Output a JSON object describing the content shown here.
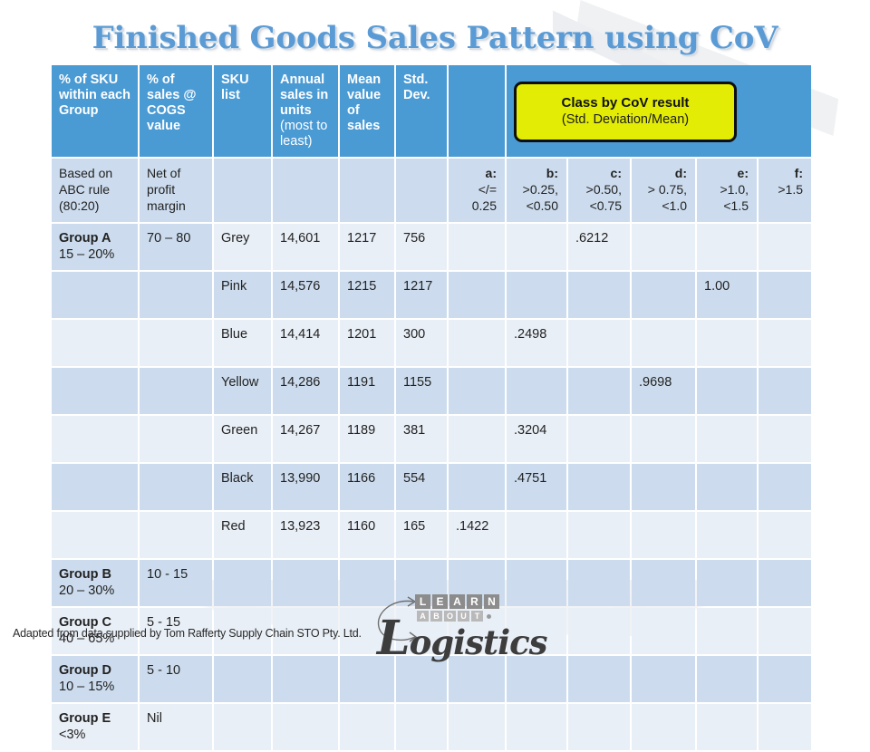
{
  "title": "Finished Goods Sales Pattern using CoV",
  "colors": {
    "title_blue": "#5b9bd5",
    "header_blue": "#4a9ad4",
    "row_light": "#e9eff7",
    "row_dark": "#ccdcee",
    "callout_yellow": "#e2ec05",
    "callout_border": "#0e0e0e"
  },
  "table": {
    "headers": {
      "pct_sku": "% of SKU within each Group",
      "pct_sales": "% of sales @ COGS value",
      "sku_list": "SKU list",
      "annual_sales_bold": "Annual sales in units",
      "annual_sales_light": "(most to least)",
      "mean_value": "Mean value of sales",
      "std_dev": "Std. Dev."
    },
    "callout": {
      "line1": "Class  by CoV result",
      "line2": "(Std.  Deviation/Mean)"
    },
    "subheaders": {
      "pct_sku": "Based on ABC rule (80:20)",
      "pct_sales": "Net of profit margin",
      "classes": [
        {
          "key": "a:",
          "range1": "</=",
          "range2": "0.25"
        },
        {
          "key": "b:",
          "range1": ">0.25,",
          "range2": "<0.50"
        },
        {
          "key": "c:",
          "range1": ">0.50,",
          "range2": "<0.75"
        },
        {
          "key": "d:",
          "range1": "> 0.75,",
          "range2": "<1.0"
        },
        {
          "key": "e:",
          "range1": ">1.0,",
          "range2": "<1.5"
        },
        {
          "key": "f:",
          "range1": ">1.5",
          "range2": ""
        }
      ]
    },
    "rows": [
      {
        "group_name": "Group A",
        "group_range": "15 – 20%",
        "pct_sales": "70 – 80",
        "sku": "Grey",
        "annual": "14,601",
        "mean": "1217",
        "std": "756",
        "a": "",
        "b": "",
        "c": ".6212",
        "d": "",
        "e": "",
        "f": "",
        "shade": "light",
        "group_shade": "dark"
      },
      {
        "group_name": "",
        "group_range": "",
        "pct_sales": "",
        "sku": "Pink",
        "annual": "14,576",
        "mean": "1215",
        "std": "1217",
        "a": "",
        "b": "",
        "c": "",
        "d": "",
        "e": "1.00",
        "f": "",
        "shade": "dark",
        "group_shade": "dark"
      },
      {
        "group_name": "",
        "group_range": "",
        "pct_sales": "",
        "sku": "Blue",
        "annual": "14,414",
        "mean": "1201",
        "std": "300",
        "a": "",
        "b": ".2498",
        "c": "",
        "d": "",
        "e": "",
        "f": "",
        "shade": "light",
        "group_shade": "light"
      },
      {
        "group_name": "",
        "group_range": "",
        "pct_sales": "",
        "sku": "Yellow",
        "annual": "14,286",
        "mean": "1191",
        "std": "1155",
        "a": "",
        "b": "",
        "c": "",
        "d": ".9698",
        "e": "",
        "f": "",
        "shade": "dark",
        "group_shade": "dark"
      },
      {
        "group_name": "",
        "group_range": "",
        "pct_sales": "",
        "sku": "Green",
        "annual": "14,267",
        "mean": "1189",
        "std": "381",
        "a": "",
        "b": ".3204",
        "c": "",
        "d": "",
        "e": "",
        "f": "",
        "shade": "light",
        "group_shade": "light"
      },
      {
        "group_name": "",
        "group_range": "",
        "pct_sales": "",
        "sku": "Black",
        "annual": "13,990",
        "mean": "1166",
        "std": "554",
        "a": "",
        "b": ".4751",
        "c": "",
        "d": "",
        "e": "",
        "f": "",
        "shade": "dark",
        "group_shade": "dark"
      },
      {
        "group_name": "",
        "group_range": "",
        "pct_sales": "",
        "sku": "Red",
        "annual": "13,923",
        "mean": "1160",
        "std": "165",
        "a": ".1422",
        "b": "",
        "c": "",
        "d": "",
        "e": "",
        "f": "",
        "shade": "light",
        "group_shade": "light"
      },
      {
        "group_name": "Group B",
        "group_range": "20 – 30%",
        "pct_sales": "10 - 15",
        "sku": "",
        "annual": "",
        "mean": "",
        "std": "",
        "a": "",
        "b": "",
        "c": "",
        "d": "",
        "e": "",
        "f": "",
        "shade": "dark",
        "group_shade": "dark"
      },
      {
        "group_name": "Group C",
        "group_range": "40 – 65%",
        "pct_sales": "5 - 15",
        "sku": "",
        "annual": "",
        "mean": "",
        "std": "",
        "a": "",
        "b": "",
        "c": "",
        "d": "",
        "e": "",
        "f": "",
        "shade": "light",
        "group_shade": "light"
      },
      {
        "group_name": "Group D",
        "group_range": "10 – 15%",
        "pct_sales": "5 - 10",
        "sku": "",
        "annual": "",
        "mean": "",
        "std": "",
        "a": "",
        "b": "",
        "c": "",
        "d": "",
        "e": "",
        "f": "",
        "shade": "dark",
        "group_shade": "dark"
      },
      {
        "group_name": "Group E",
        "group_range": "<3%",
        "pct_sales": "Nil",
        "sku": "",
        "annual": "",
        "mean": "",
        "std": "",
        "a": "",
        "b": "",
        "c": "",
        "d": "",
        "e": "",
        "f": "",
        "shade": "light",
        "group_shade": "light"
      }
    ]
  },
  "footer": {
    "credit": "Adapted from data supplied by Tom Rafferty Supply Chain STO Pty. Ltd."
  },
  "logo": {
    "learn": "LEARN",
    "about": "ABOUT",
    "script_initial": "L",
    "script_rest": "ogistics"
  }
}
